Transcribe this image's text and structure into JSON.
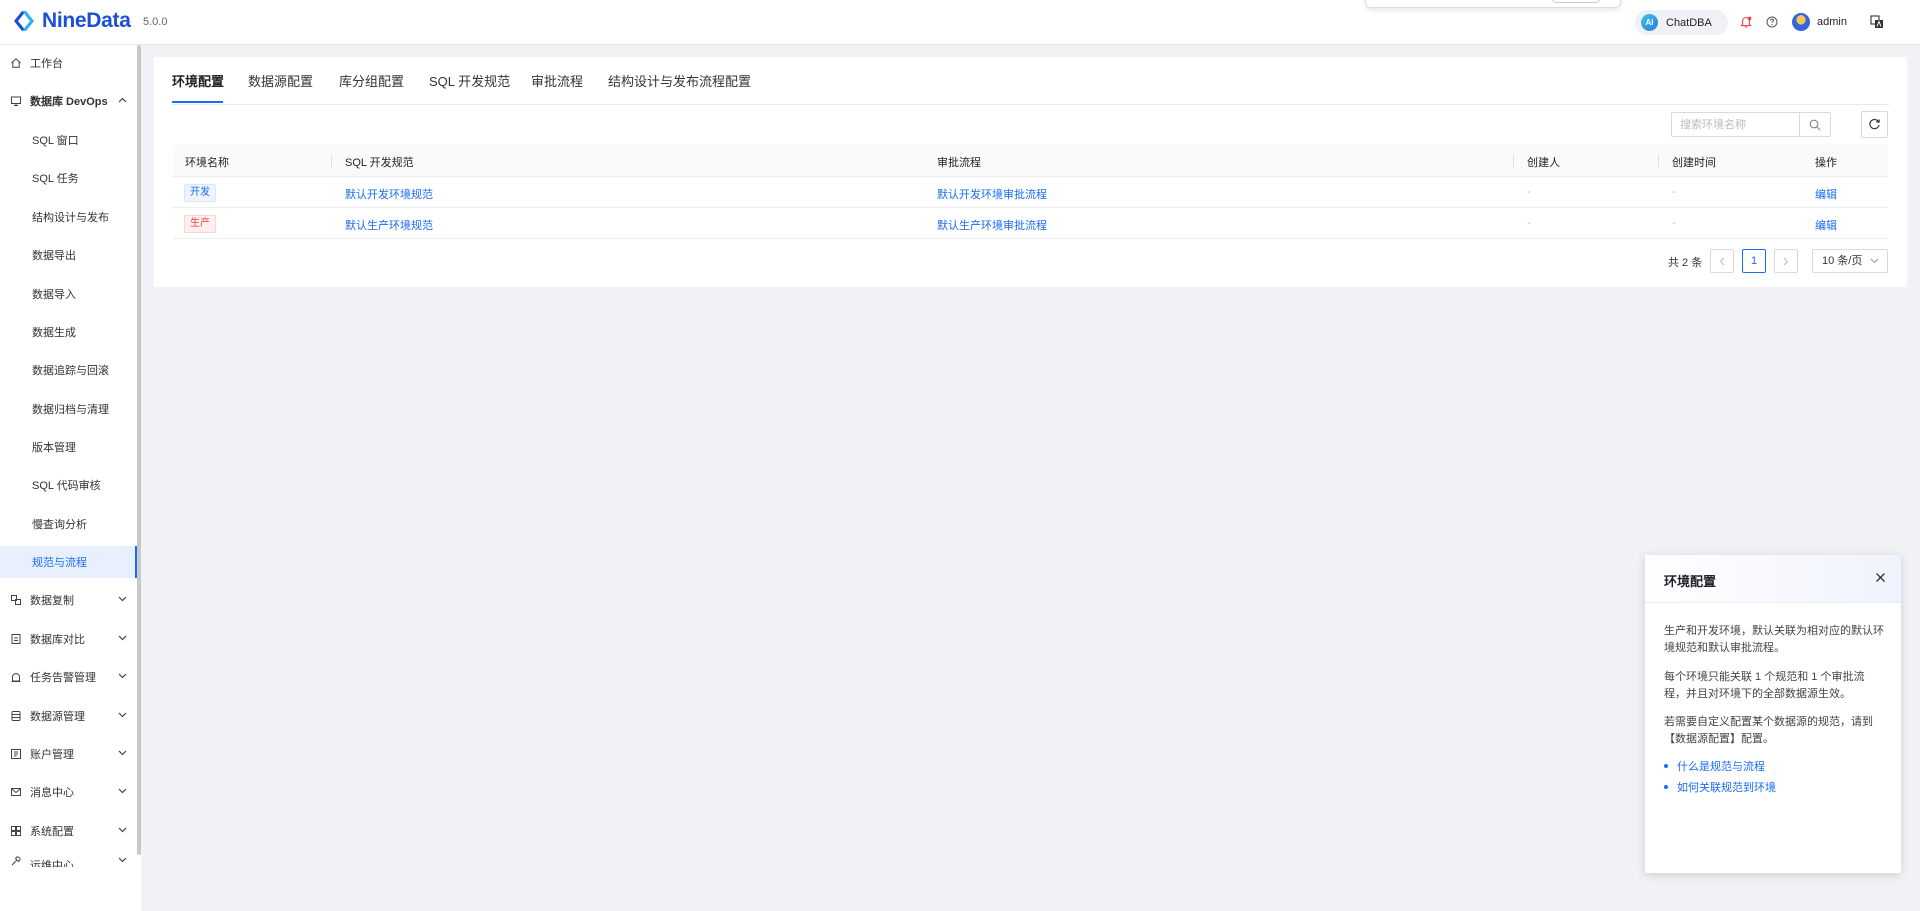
{
  "header": {
    "brand": "NineData",
    "version": "5.0.0",
    "chatdba_label": "ChatDBA",
    "ai_badge": "AI",
    "username": "admin"
  },
  "sidebar": {
    "items": [
      {
        "label": "工作台",
        "icon": "home-icon"
      },
      {
        "label": "数据库 DevOps",
        "icon": "devops-icon",
        "expanded": true
      },
      {
        "label": "SQL 窗口"
      },
      {
        "label": "SQL 任务"
      },
      {
        "label": "结构设计与发布"
      },
      {
        "label": "数据导出"
      },
      {
        "label": "数据导入"
      },
      {
        "label": "数据生成"
      },
      {
        "label": "数据追踪与回滚"
      },
      {
        "label": "数据归档与清理"
      },
      {
        "label": "版本管理"
      },
      {
        "label": "SQL 代码审核"
      },
      {
        "label": "慢查询分析"
      },
      {
        "label": "规范与流程",
        "active": true
      },
      {
        "label": "数据复制",
        "icon": "replication-icon"
      },
      {
        "label": "数据库对比",
        "icon": "compare-icon"
      },
      {
        "label": "任务告警管理",
        "icon": "alarm-icon"
      },
      {
        "label": "数据源管理",
        "icon": "datasource-icon"
      },
      {
        "label": "账户管理",
        "icon": "account-icon"
      },
      {
        "label": "消息中心",
        "icon": "mail-icon"
      },
      {
        "label": "系统配置",
        "icon": "grid-icon"
      },
      {
        "label": "运维中心",
        "icon": "wrench-icon"
      }
    ]
  },
  "tabs": [
    "环境配置",
    "数据源配置",
    "库分组配置",
    "SQL 开发规范",
    "审批流程",
    "结构设计与发布流程配置"
  ],
  "search": {
    "placeholder": "搜索环境名称"
  },
  "table": {
    "columns": [
      "环境名称",
      "SQL 开发规范",
      "审批流程",
      "创建人",
      "创建时间",
      "操作"
    ],
    "rows": [
      {
        "env": "开发",
        "spec": "默认开发环境规范",
        "flow": "默认开发环境审批流程",
        "creator": "-",
        "created": "-",
        "action": "编辑"
      },
      {
        "env": "生产",
        "spec": "默认生产环境规范",
        "flow": "默认生产环境审批流程",
        "creator": "-",
        "created": "-",
        "action": "编辑"
      }
    ]
  },
  "pagination": {
    "total": "共 2 条",
    "current": "1",
    "page_size": "10 条/页"
  },
  "help": {
    "title": "环境配置",
    "p1": "生产和开发环境，默认关联为相对应的默认环境规范和默认审批流程。",
    "p2": "每个环境只能关联 1 个规范和 1 个审批流程，并且对环境下的全部数据源生效。",
    "p3": "若需要自定义配置某个数据源的规范，请到【数据源配置】配置。",
    "links": [
      "什么是规范与流程",
      "如何关联规范到环境"
    ]
  },
  "colors": {
    "accent": "#1a6cf5",
    "brand": "#1a4fd6",
    "prod_tag": "#e8453c"
  }
}
